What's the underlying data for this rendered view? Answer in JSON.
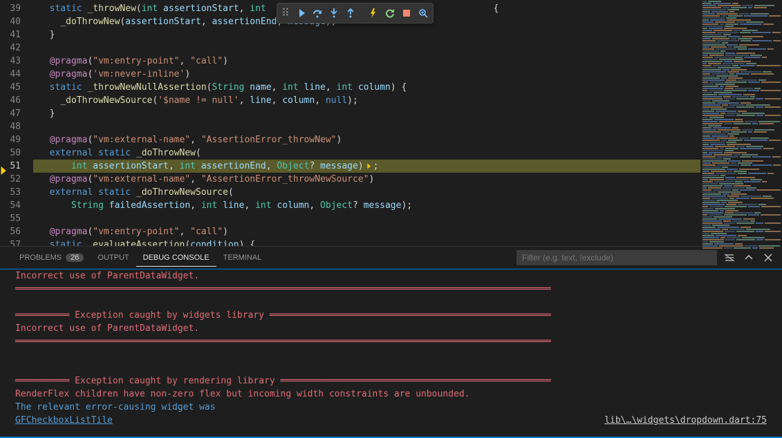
{
  "editor": {
    "firstLine": 39,
    "lastLine": 57,
    "currentLine": 51,
    "lines": {
      "39": [
        [
          "kw",
          "  static"
        ],
        [
          "id",
          " "
        ],
        [
          "fn",
          "_throwNew"
        ],
        [
          "id",
          "("
        ],
        [
          "ty",
          "int"
        ],
        [
          "id",
          " "
        ],
        [
          "va",
          "assertionStart"
        ],
        [
          "id",
          ", "
        ],
        [
          "ty",
          "int"
        ],
        [
          "id",
          "                                          {"
        ]
      ],
      "40": [
        [
          "id",
          "    "
        ],
        [
          "fn",
          "_doThrowNew"
        ],
        [
          "id",
          "("
        ],
        [
          "va",
          "assertionStart"
        ],
        [
          "id",
          ", "
        ],
        [
          "va",
          "assertionEnd"
        ],
        [
          "id",
          ", "
        ],
        [
          "va",
          "message"
        ],
        [
          "id",
          ");"
        ]
      ],
      "41": [
        [
          "id",
          "  }"
        ]
      ],
      "42": [
        [
          "id",
          ""
        ]
      ],
      "43": [
        [
          "id",
          "  "
        ],
        [
          "cb",
          "@pragma"
        ],
        [
          "id",
          "("
        ],
        [
          "str",
          "\"vm:entry-point\""
        ],
        [
          "id",
          ", "
        ],
        [
          "str",
          "\"call\""
        ],
        [
          "id",
          ")"
        ]
      ],
      "44": [
        [
          "id",
          "  "
        ],
        [
          "cb",
          "@pragma"
        ],
        [
          "id",
          "("
        ],
        [
          "str",
          "'vm:never-inline'"
        ],
        [
          "id",
          ")"
        ]
      ],
      "45": [
        [
          "id",
          "  "
        ],
        [
          "kw",
          "static"
        ],
        [
          "id",
          " "
        ],
        [
          "fn",
          "_throwNewNullAssertion"
        ],
        [
          "id",
          "("
        ],
        [
          "ty",
          "String"
        ],
        [
          "id",
          " "
        ],
        [
          "va",
          "name"
        ],
        [
          "id",
          ", "
        ],
        [
          "ty",
          "int"
        ],
        [
          "id",
          " "
        ],
        [
          "va",
          "line"
        ],
        [
          "id",
          ", "
        ],
        [
          "ty",
          "int"
        ],
        [
          "id",
          " "
        ],
        [
          "va",
          "column"
        ],
        [
          "id",
          ") {"
        ]
      ],
      "46": [
        [
          "id",
          "    "
        ],
        [
          "fn",
          "_doThrowNewSource"
        ],
        [
          "id",
          "("
        ],
        [
          "str",
          "'$name != null'"
        ],
        [
          "id",
          ", "
        ],
        [
          "va",
          "line"
        ],
        [
          "id",
          ", "
        ],
        [
          "va",
          "column"
        ],
        [
          "id",
          ", "
        ],
        [
          "kw",
          "null"
        ],
        [
          "id",
          ");"
        ]
      ],
      "47": [
        [
          "id",
          "  }"
        ]
      ],
      "48": [
        [
          "id",
          ""
        ]
      ],
      "49": [
        [
          "id",
          "  "
        ],
        [
          "cb",
          "@pragma"
        ],
        [
          "id",
          "("
        ],
        [
          "str",
          "\"vm:external-name\""
        ],
        [
          "id",
          ", "
        ],
        [
          "str",
          "\"AssertionError_throwNew\""
        ],
        [
          "id",
          ")"
        ]
      ],
      "50": [
        [
          "id",
          "  "
        ],
        [
          "kw",
          "external"
        ],
        [
          "id",
          " "
        ],
        [
          "kw",
          "static"
        ],
        [
          "id",
          " "
        ],
        [
          "fn",
          "_doThrowNew"
        ],
        [
          "id",
          "("
        ]
      ],
      "51": [
        [
          "id",
          "      "
        ],
        [
          "ty",
          "int"
        ],
        [
          "id",
          " "
        ],
        [
          "va",
          "assertionStart"
        ],
        [
          "id",
          ", "
        ],
        [
          "ty",
          "int"
        ],
        [
          "id",
          " "
        ],
        [
          "va",
          "assertionEnd"
        ],
        [
          "id",
          ", "
        ],
        [
          "ty",
          "Object"
        ],
        [
          "id",
          "? "
        ],
        [
          "va",
          "message"
        ],
        [
          "id",
          ")"
        ],
        [
          "exec",
          ""
        ],
        [
          "id",
          ";"
        ]
      ],
      "52": [
        [
          "id",
          "  "
        ],
        [
          "cb",
          "@pragma"
        ],
        [
          "id",
          "("
        ],
        [
          "str",
          "\"vm:external-name\""
        ],
        [
          "id",
          ", "
        ],
        [
          "str",
          "\"AssertionError_throwNewSource\""
        ],
        [
          "id",
          ")"
        ]
      ],
      "53": [
        [
          "id",
          "  "
        ],
        [
          "kw",
          "external"
        ],
        [
          "id",
          " "
        ],
        [
          "kw",
          "static"
        ],
        [
          "id",
          " "
        ],
        [
          "fn",
          "_doThrowNewSource"
        ],
        [
          "id",
          "("
        ]
      ],
      "54": [
        [
          "id",
          "      "
        ],
        [
          "ty",
          "String"
        ],
        [
          "id",
          " "
        ],
        [
          "va",
          "failedAssertion"
        ],
        [
          "id",
          ", "
        ],
        [
          "ty",
          "int"
        ],
        [
          "id",
          " "
        ],
        [
          "va",
          "line"
        ],
        [
          "id",
          ", "
        ],
        [
          "ty",
          "int"
        ],
        [
          "id",
          " "
        ],
        [
          "va",
          "column"
        ],
        [
          "id",
          ", "
        ],
        [
          "ty",
          "Object"
        ],
        [
          "id",
          "? "
        ],
        [
          "va",
          "message"
        ],
        [
          "id",
          ");"
        ]
      ],
      "55": [
        [
          "id",
          ""
        ]
      ],
      "56": [
        [
          "id",
          "  "
        ],
        [
          "cb",
          "@pragma"
        ],
        [
          "id",
          "("
        ],
        [
          "str",
          "\"vm:entry-point\""
        ],
        [
          "id",
          ", "
        ],
        [
          "str",
          "\"call\""
        ],
        [
          "id",
          ")"
        ]
      ],
      "57": [
        [
          "id",
          "  "
        ],
        [
          "kw",
          "static"
        ],
        [
          "id",
          " "
        ],
        [
          "fn",
          "_evaluateAssertion"
        ],
        [
          "id",
          "("
        ],
        [
          "va",
          "condition"
        ],
        [
          "id",
          ") {"
        ]
      ]
    }
  },
  "debugToolbar": {
    "continue": "Continue",
    "stepOver": "Step Over",
    "stepInto": "Step Into",
    "stepOut": "Step Out",
    "hotReload": "Hot Reload",
    "restart": "Restart",
    "stop": "Stop",
    "inspect": "Open DevTools"
  },
  "panel": {
    "tabs": {
      "problems": "Problems",
      "problemsCount": "26",
      "output": "Output",
      "debug": "Debug Console",
      "terminal": "Terminal"
    },
    "filterPlaceholder": "Filter (e.g. text, !exclude)",
    "console": [
      {
        "cls": "err",
        "text": "Incorrect use of ParentDataWidget."
      },
      {
        "cls": "sep",
        "text": "═══════════════════════════════════════════════════════════════════════════════════════════════════"
      },
      {
        "cls": "",
        "text": ""
      },
      {
        "cls": "sep",
        "text": "══════════ Exception caught by widgets library ════════════════════════════════════════════════════"
      },
      {
        "cls": "err",
        "text": "Incorrect use of ParentDataWidget."
      },
      {
        "cls": "sep",
        "text": "═══════════════════════════════════════════════════════════════════════════════════════════════════"
      },
      {
        "cls": "",
        "text": ""
      },
      {
        "cls": "",
        "text": ""
      },
      {
        "cls": "sep",
        "text": "══════════ Exception caught by rendering library ══════════════════════════════════════════════════"
      },
      {
        "cls": "err",
        "text": "RenderFlex children have non-zero flex but incoming width constraints are unbounded."
      },
      {
        "cls": "narr",
        "text": "The relevant error-causing widget was"
      },
      {
        "cls": "link",
        "text": "GFCheckboxListTile",
        "file": "lib\\…\\widgets\\dropdown.dart:75"
      }
    ]
  }
}
